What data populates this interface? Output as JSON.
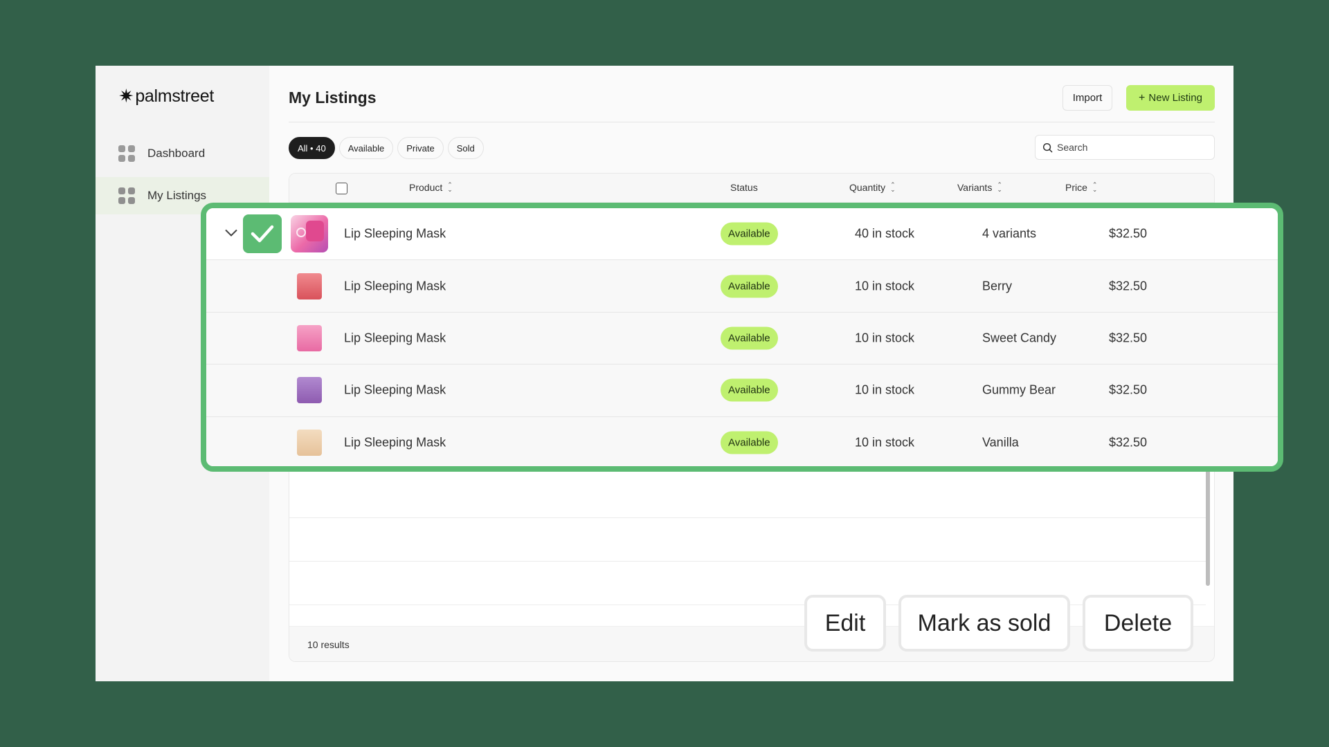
{
  "app": {
    "brand": "palmstreet",
    "brand_mark": "✷"
  },
  "sidebar": {
    "items": [
      {
        "label": "Dashboard",
        "icon": "grid-icon",
        "active": false
      },
      {
        "label": "My Listings",
        "icon": "grid-icon",
        "active": true
      }
    ]
  },
  "header": {
    "title": "My Listings",
    "import_label": "Import",
    "new_listing_label": "New Listing"
  },
  "filters": {
    "chips": [
      "All • 40",
      "Available",
      "Private",
      "Sold"
    ],
    "active": "All • 40"
  },
  "search": {
    "placeholder": "Search"
  },
  "table": {
    "columns": [
      "Product",
      "Status",
      "Quantity",
      "Variants",
      "Price"
    ],
    "rows": [
      {
        "product": "Lip Sleeping Mask",
        "status": "Available",
        "quantity": "40 in stock",
        "variants": "4 variants",
        "price": "$32.50",
        "parent": true,
        "selected": true,
        "expanded": true,
        "jar_color": "#e0498f"
      },
      {
        "product": "Lip Sleeping Mask",
        "status": "Available",
        "quantity": "10 in stock",
        "variants": "Berry",
        "price": "$32.50",
        "jar_color": "#d9525b"
      },
      {
        "product": "Lip Sleeping Mask",
        "status": "Available",
        "quantity": "10 in stock",
        "variants": "Sweet Candy",
        "price": "$32.50",
        "jar_color": "#e86aa3"
      },
      {
        "product": "Lip Sleeping Mask",
        "status": "Available",
        "quantity": "10 in stock",
        "variants": "Gummy Bear",
        "price": "$32.50",
        "jar_color": "#8e5bb0"
      },
      {
        "product": "Lip Sleeping Mask",
        "status": "Available",
        "quantity": "10 in stock",
        "variants": "Vanilla",
        "price": "$32.50",
        "jar_color": "#e6c29a"
      }
    ],
    "results_label": "10 results"
  },
  "actions": {
    "edit": "Edit",
    "mark_sold": "Mark as sold",
    "delete": "Delete"
  },
  "colors": {
    "background": "#326049",
    "accent": "#bff06f",
    "selection": "#5cbb73"
  }
}
